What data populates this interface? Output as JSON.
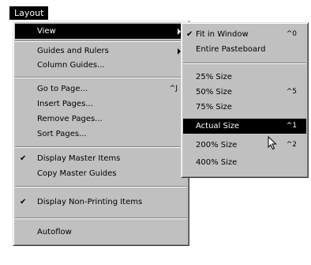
{
  "menubar": {
    "title": "Layout"
  },
  "layout_menu": {
    "items": [
      {
        "label": "View",
        "submenu": true,
        "selected": true
      },
      {
        "label": "Guides and Rulers",
        "submenu": true
      },
      {
        "label": "Column Guides..."
      },
      {
        "label": "Go to Page...",
        "shortcut": "^J"
      },
      {
        "label": "Insert Pages..."
      },
      {
        "label": "Remove Pages..."
      },
      {
        "label": "Sort Pages..."
      },
      {
        "label": "Display Master Items",
        "checked": true
      },
      {
        "label": "Copy Master Guides"
      },
      {
        "label": "Display Non-Printing Items",
        "checked": true
      },
      {
        "label": "Autoflow"
      }
    ]
  },
  "view_submenu": {
    "items": [
      {
        "label": "Fit in Window",
        "shortcut": "^0",
        "checked": true
      },
      {
        "label": "Entire Pasteboard"
      },
      {
        "label": "25% Size"
      },
      {
        "label": "50% Size",
        "shortcut": "^5"
      },
      {
        "label": "75% Size"
      },
      {
        "label": "Actual Size",
        "shortcut": "^1",
        "selected": true
      },
      {
        "label": "200% Size",
        "shortcut": "^2"
      },
      {
        "label": "400% Size"
      }
    ]
  },
  "glyphs": {
    "check": "✔"
  }
}
